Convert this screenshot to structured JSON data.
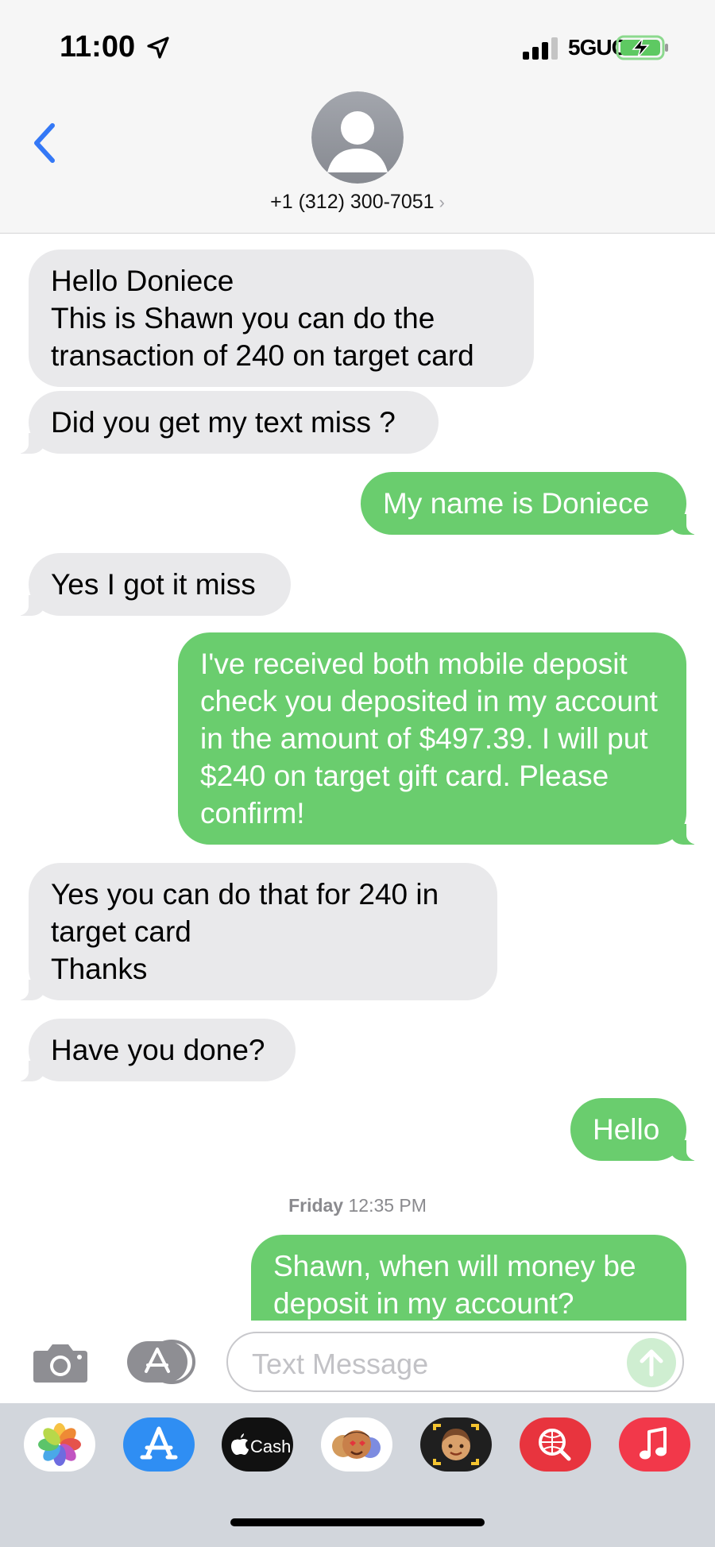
{
  "status_bar": {
    "time": "11:00",
    "network": "5GUC"
  },
  "header": {
    "contact": "+1 (312) 300-7051",
    "chevron": "›"
  },
  "messages": [
    {
      "from": "them",
      "text": "Hello Doniece\nThis is Shawn you can do the transaction of 240 on target card"
    },
    {
      "from": "them",
      "text": "Did you get my text miss ?"
    },
    {
      "from": "me",
      "text": "My name is Doniece"
    },
    {
      "from": "them",
      "text": "Yes I got it miss"
    },
    {
      "from": "me",
      "text": "I've received both mobile deposit check you deposited in my account in the amount of $497.39. I will put $240 on target gift card. Please confirm!"
    },
    {
      "from": "them",
      "text": "Yes you can do that for 240 in target card\nThanks"
    },
    {
      "from": "them",
      "text": "Have you done?"
    },
    {
      "from": "me",
      "text": "Hello"
    },
    {
      "from": "me",
      "text": "Shawn, when will money be deposit in my account?"
    }
  ],
  "timestamp": {
    "day": "Friday",
    "time": "12:35 PM"
  },
  "composer": {
    "placeholder": "Text Message"
  },
  "app_tray": {
    "cash_label": "Cash",
    "apps": [
      "photos-icon",
      "app-store-icon",
      "apple-cash-icon",
      "memoji-stickers-icon",
      "memoji-icon",
      "search-images-icon",
      "music-icon"
    ]
  },
  "colors": {
    "outgoing": "#6acd6e",
    "incoming": "#e9e9eb",
    "accent": "#3478f6"
  }
}
